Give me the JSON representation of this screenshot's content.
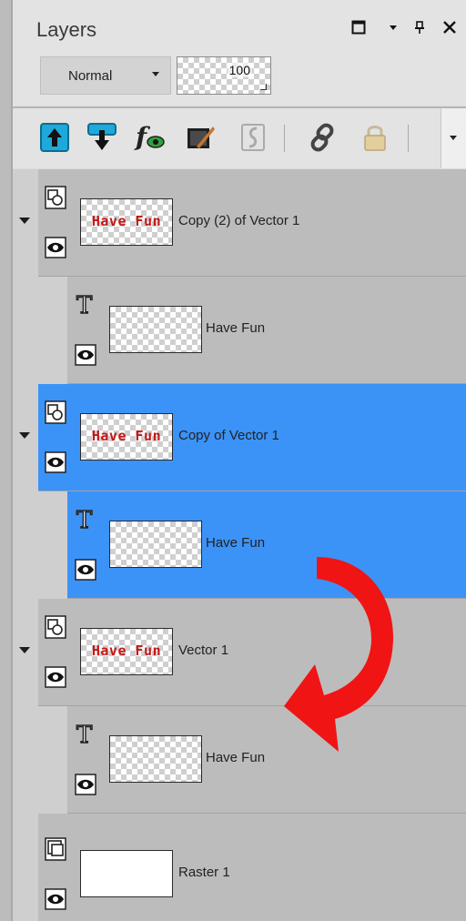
{
  "window": {
    "title": "Layers",
    "controls": [
      "restore-icon",
      "dropdown-icon",
      "pin-icon",
      "close-icon"
    ]
  },
  "blend": {
    "mode": "Normal",
    "opacity": "100"
  },
  "toolbar": {
    "icons": [
      "new-raster-layer-icon",
      "new-vector-layer-icon",
      "layer-style-icon",
      "edit-selection-icon",
      "mask-icon",
      "link-icon",
      "lock-icon",
      "more-dropdown-icon"
    ]
  },
  "layers": [
    {
      "name": "Copy (2) of Vector 1",
      "type": "vector-group",
      "thumb_text": "Have Fun",
      "selected": false,
      "expanded": true
    },
    {
      "name": "Have Fun",
      "type": "text",
      "selected": false
    },
    {
      "name": "Copy of Vector 1",
      "type": "vector-group",
      "thumb_text": "Have Fun",
      "selected": true,
      "expanded": true
    },
    {
      "name": "Have Fun",
      "type": "text",
      "selected": true
    },
    {
      "name": "Vector 1",
      "type": "vector-group",
      "thumb_text": "Have Fun",
      "selected": false,
      "expanded": true
    },
    {
      "name": "Have Fun",
      "type": "text",
      "selected": false
    },
    {
      "name": "Raster 1",
      "type": "raster",
      "selected": false
    }
  ],
  "colors": {
    "selection": "#3b93f7",
    "row": "#bcbcbc",
    "annotation_arrow": "#f01414",
    "thumb_text": "#c51616"
  },
  "annotation": "curved-red-arrow"
}
